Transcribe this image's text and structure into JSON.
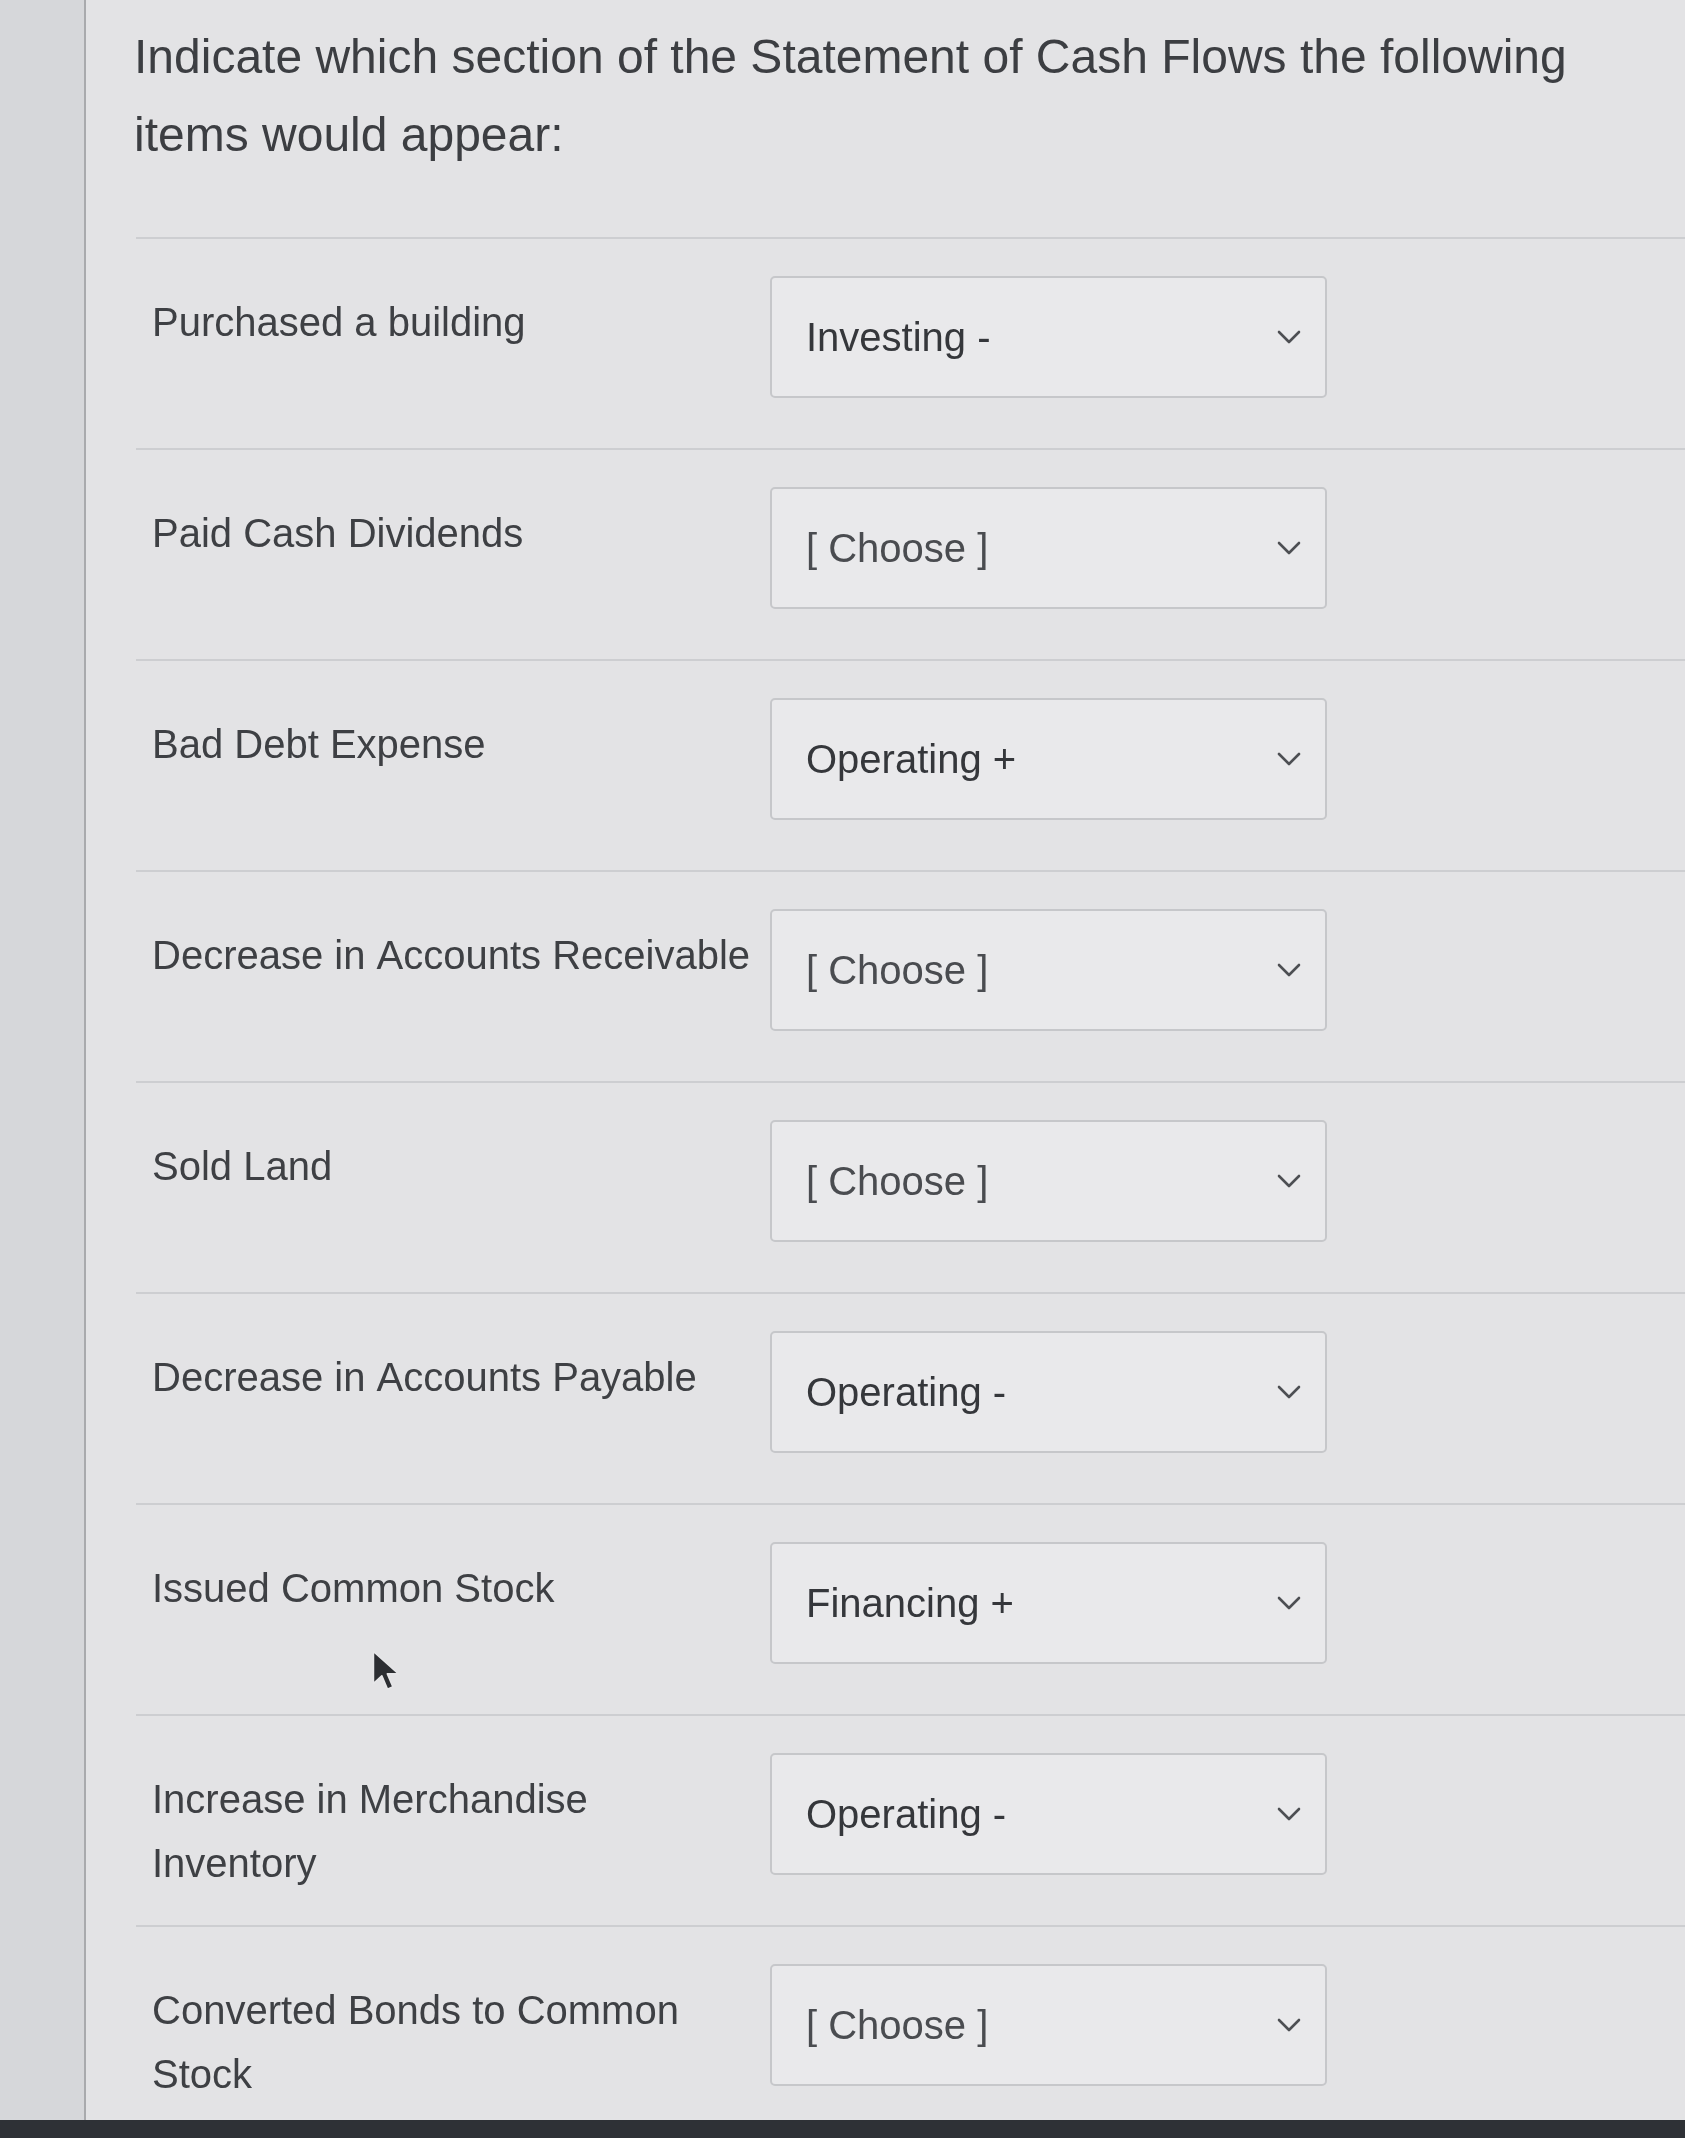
{
  "prompt": "Indicate which section of the Statement of Cash Flows the following items would appear:",
  "items": [
    {
      "label": "Purchased a building",
      "value": "Investing -"
    },
    {
      "label": "Paid Cash Dividends",
      "placeholder": "[ Choose ]"
    },
    {
      "label": "Bad Debt Expense",
      "value": "Operating +"
    },
    {
      "label": "Decrease in Accounts Receivable",
      "placeholder": "[ Choose ]"
    },
    {
      "label": "Sold Land",
      "placeholder": "[ Choose ]"
    },
    {
      "label": "Decrease in Accounts Payable",
      "value": "Operating -"
    },
    {
      "label": "Issued Common Stock",
      "value": "Financing +"
    },
    {
      "label": "Increase in Merchandise Inventory",
      "value": "Operating -"
    },
    {
      "label": "Converted Bonds to Common Stock",
      "placeholder": "[ Choose ]"
    }
  ]
}
